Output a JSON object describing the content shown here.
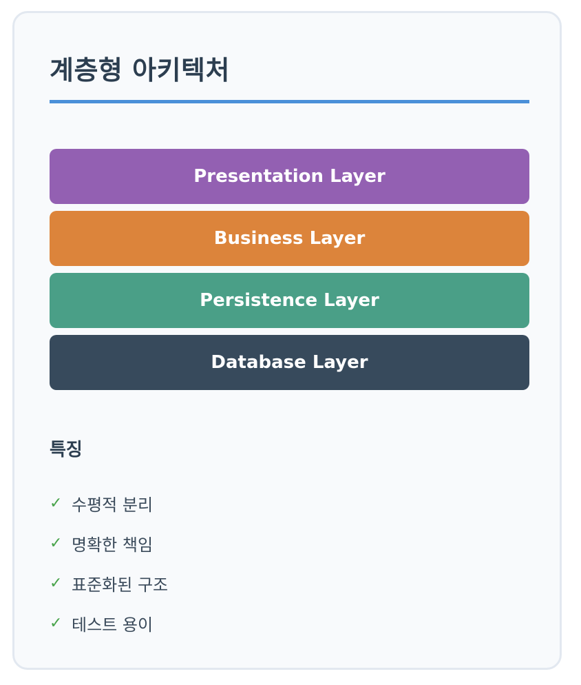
{
  "title": "계층형 아키텍처",
  "colors": {
    "accent_rule": "#4a90d9",
    "check": "#48a34a"
  },
  "layers": [
    {
      "label": "Presentation Layer",
      "color": "#9360b2"
    },
    {
      "label": "Business Layer",
      "color": "#dc843b"
    },
    {
      "label": "Persistence Layer",
      "color": "#4a9f87"
    },
    {
      "label": "Database Layer",
      "color": "#374a5c"
    }
  ],
  "features": {
    "heading": "특징",
    "check_symbol": "✓",
    "items": [
      "수평적 분리",
      "명확한 책임",
      "표준화된 구조",
      "테스트 용이"
    ]
  }
}
